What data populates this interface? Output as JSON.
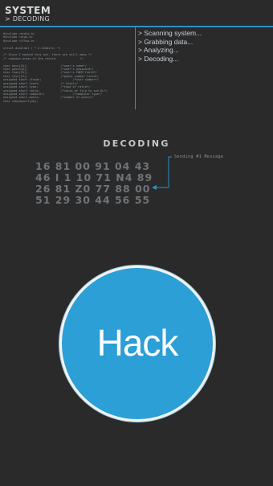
{
  "header": {
    "title": "SYSTEM",
    "subtitle": "> DECODING"
  },
  "code_lines": [
    "#include <stdio.h>",
    "#include <stgs.h>",
    "#include <lftuo.h>",
    "",
    "struct availabl ( * 2.11kbits; *)",
    "",
    "/* Since I hacked this out, there are still many */",
    "/* unknown areas of the record              */",
    "",
    "char hacn[25];                   /*user's name*/",
    "char passh[8];                   /*user's password*/",
    "char fnan[25];                   /*user's FNEM field*/",
    "char less[15];                   /*phone number field*/",
    "unsigned short ifnuan;                  /*user number*/",
    "unsigned short level;            /* level*/",
    "unsigned short type;             /*type of ratio*/",
    "unsigned short ratio;            /*ratio of file to son DL*/",
    "unsigned short computer;                /*computer type*/",
    "unsigned short posts;            /*number of posts*/",
    "char unknownuff[40];"
  ],
  "status_lines": [
    "> Scanning system...",
    "> Grabbing data...",
    "> Analyzing...",
    "> Decoding..."
  ],
  "decoding": {
    "title": "DECODING",
    "rows": [
      "16 81 00 91 04 43",
      "46 I 1 10 71 N4 89",
      "26 81 Z0 77 88 00",
      "51 29 30 44 56 55"
    ],
    "bracket_label": "Sending #1 Message"
  },
  "hack_button": {
    "label": "Hack"
  },
  "colors": {
    "background": "#2a2a2a",
    "accent": "#2f8fc3",
    "button": "#2b9fd6",
    "button_border": "#f2f2f2"
  }
}
